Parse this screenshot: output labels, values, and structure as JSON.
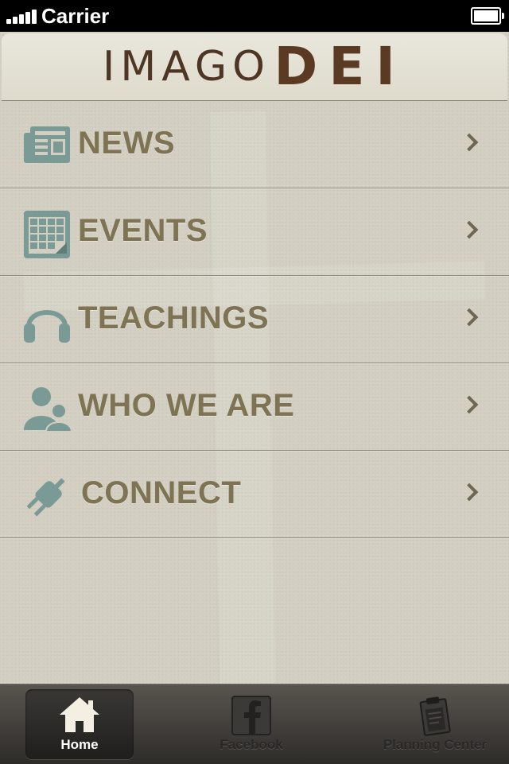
{
  "status_bar": {
    "carrier": "Carrier"
  },
  "header": {
    "logo_part1": "IMAGO",
    "logo_part2": "DEI"
  },
  "menu": {
    "items": [
      {
        "label": "NEWS",
        "icon": "newspaper-icon"
      },
      {
        "label": "EVENTS",
        "icon": "calendar-icon"
      },
      {
        "label": "TEACHINGS",
        "icon": "headphones-icon"
      },
      {
        "label": "WHO WE ARE",
        "icon": "people-icon"
      },
      {
        "label": "CONNECT",
        "icon": "plug-icon"
      }
    ]
  },
  "tab_bar": {
    "tabs": [
      {
        "label": "Home",
        "icon": "home-icon",
        "active": true
      },
      {
        "label": "Facebook",
        "icon": "facebook-icon",
        "active": false
      },
      {
        "label": "Planning Center",
        "icon": "clipboard-icon",
        "active": false
      }
    ]
  },
  "colors": {
    "menu_text": "#7e7453",
    "icon_teal": "#7a9a96",
    "logo_brown": "#5a3a22",
    "background": "#d2cec1"
  }
}
